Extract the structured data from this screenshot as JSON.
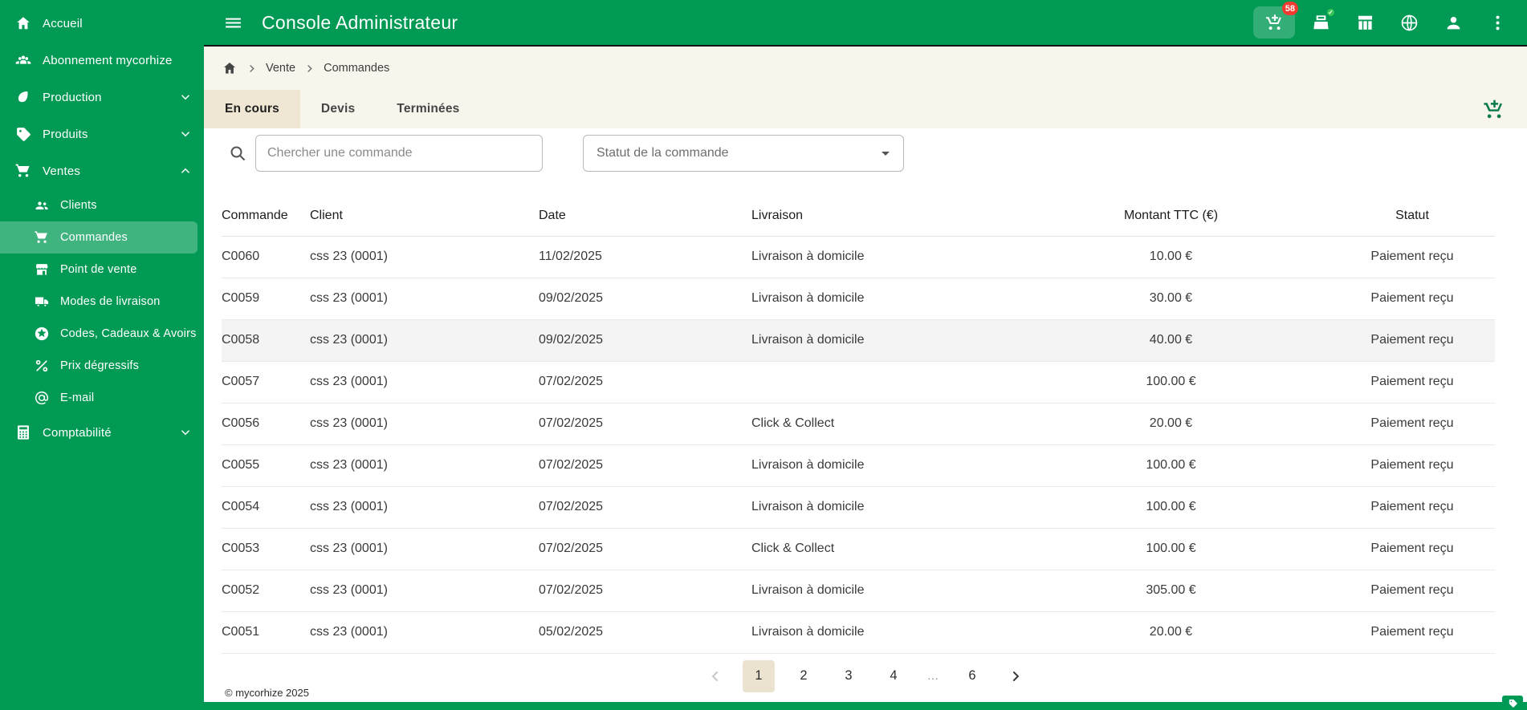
{
  "theme": {
    "brand_green": "#009a55",
    "badge_red": "#f13a30",
    "tab_beige": "#efe7d4",
    "head_band": "#f8f5ed",
    "row_hover": "#f4f4f4",
    "content_green": "#0a7c47"
  },
  "app": {
    "title": "Console Administrateur"
  },
  "topbar": {
    "cart_badge": "58"
  },
  "sidebar": {
    "items": [
      {
        "label": "Accueil"
      },
      {
        "label": "Abonnement mycorhize"
      },
      {
        "label": "Production"
      },
      {
        "label": "Produits"
      },
      {
        "label": "Ventes"
      },
      {
        "label": "Clients"
      },
      {
        "label": "Commandes"
      },
      {
        "label": "Point de vente"
      },
      {
        "label": "Modes de livraison"
      },
      {
        "label": "Codes, Cadeaux & Avoirs"
      },
      {
        "label": "Prix dégressifs"
      },
      {
        "label": "E-mail"
      },
      {
        "label": "Comptabilité"
      }
    ]
  },
  "breadcrumb": {
    "items": [
      "Vente",
      "Commandes"
    ]
  },
  "tabs": [
    {
      "label": "En cours"
    },
    {
      "label": "Devis"
    },
    {
      "label": "Terminées"
    }
  ],
  "filters": {
    "search_placeholder": "Chercher une commande",
    "status_placeholder": "Statut de la commande"
  },
  "table": {
    "columns": [
      "Commande",
      "Client",
      "Date",
      "Livraison",
      "Montant TTC (€)",
      "Statut"
    ],
    "rows": [
      {
        "commande": "C0060",
        "client": "css 23 (0001)",
        "date": "11/02/2025",
        "livraison": "Livraison à domicile",
        "montant": "10.00 €",
        "statut": "Paiement reçu"
      },
      {
        "commande": "C0059",
        "client": "css 23 (0001)",
        "date": "09/02/2025",
        "livraison": "Livraison à domicile",
        "montant": "30.00 €",
        "statut": "Paiement reçu"
      },
      {
        "commande": "C0058",
        "client": "css 23 (0001)",
        "date": "09/02/2025",
        "livraison": "Livraison à domicile",
        "montant": "40.00 €",
        "statut": "Paiement reçu"
      },
      {
        "commande": "C0057",
        "client": "css 23 (0001)",
        "date": "07/02/2025",
        "livraison": "",
        "montant": "100.00 €",
        "statut": "Paiement reçu"
      },
      {
        "commande": "C0056",
        "client": "css 23 (0001)",
        "date": "07/02/2025",
        "livraison": "Click & Collect",
        "montant": "20.00 €",
        "statut": "Paiement reçu"
      },
      {
        "commande": "C0055",
        "client": "css 23 (0001)",
        "date": "07/02/2025",
        "livraison": "Livraison à domicile",
        "montant": "100.00 €",
        "statut": "Paiement reçu"
      },
      {
        "commande": "C0054",
        "client": "css 23 (0001)",
        "date": "07/02/2025",
        "livraison": "Livraison à domicile",
        "montant": "100.00 €",
        "statut": "Paiement reçu"
      },
      {
        "commande": "C0053",
        "client": "css 23 (0001)",
        "date": "07/02/2025",
        "livraison": "Click & Collect",
        "montant": "100.00 €",
        "statut": "Paiement reçu"
      },
      {
        "commande": "C0052",
        "client": "css 23 (0001)",
        "date": "07/02/2025",
        "livraison": "Livraison à domicile",
        "montant": "305.00 €",
        "statut": "Paiement reçu"
      },
      {
        "commande": "C0051",
        "client": "css 23 (0001)",
        "date": "05/02/2025",
        "livraison": "Livraison à domicile",
        "montant": "20.00 €",
        "statut": "Paiement reçu"
      }
    ]
  },
  "pagination": {
    "pages": [
      "1",
      "2",
      "3",
      "4",
      "…",
      "6"
    ],
    "active_page": "1"
  },
  "footer": {
    "copyright": "© mycorhize 2025"
  }
}
